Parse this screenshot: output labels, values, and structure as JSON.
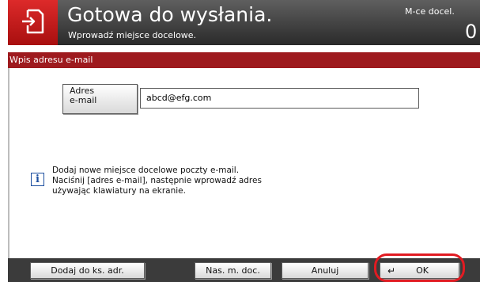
{
  "header": {
    "title": "Gotowa do wysłania.",
    "subtitle": "Wprowadź miejsce docelowe.",
    "dest_label": "M-ce docel.",
    "dest_count": "0",
    "icon": "send-document-icon"
  },
  "panel": {
    "title": "Wpis adresu e-mail",
    "address_button": {
      "line1": "Adres",
      "line2": "e-mail"
    },
    "address_value": "abcd@efg.com",
    "info_icon": "info-icon",
    "info_lines": [
      "Dodaj nowe miejsce docelowe poczty e-mail.",
      "Naciśnij [adres e-mail], następnie wprowadź adres",
      "używając klawiatury na ekranie."
    ]
  },
  "footer": {
    "add_to_book": "Dodaj do ks. adr.",
    "next_dest": "Nas. m. doc.",
    "cancel": "Anuluj",
    "ok": "OK",
    "ok_icon": "enter-icon"
  },
  "colors": {
    "accent_red": "#9e1a1e",
    "icon_red": "#c41a1a",
    "highlight": "#e11b22",
    "info_blue": "#1d4fa0"
  }
}
